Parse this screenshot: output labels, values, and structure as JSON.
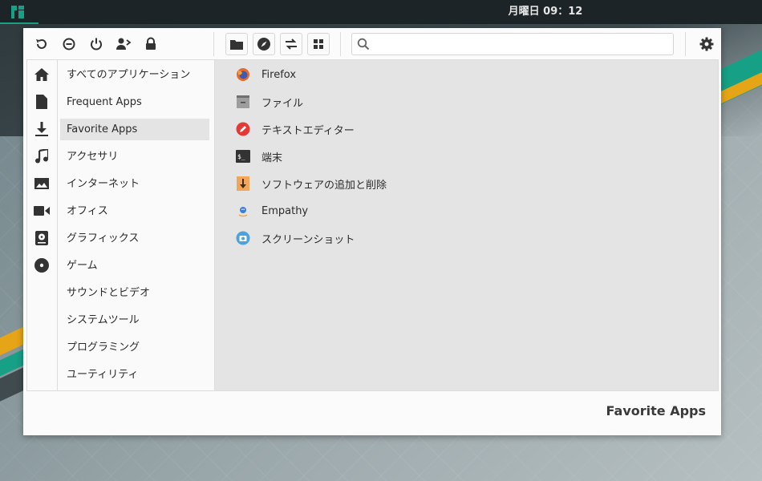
{
  "panel": {
    "clock": "月曜日 09：12"
  },
  "toolbar": {
    "left_icons": [
      "refresh-icon",
      "lock-screen-icon",
      "power-icon",
      "switch-user-icon",
      "lock-icon"
    ],
    "place_icons": [
      "folder-icon",
      "compass-icon",
      "switch-view-icon",
      "grid-icon"
    ],
    "search_placeholder": ""
  },
  "sidebar_icons": [
    "home-icon",
    "document-icon",
    "download-icon",
    "music-icon",
    "image-icon",
    "video-icon",
    "drive-icon",
    "disc-icon"
  ],
  "categories": [
    "すべてのアプリケーション",
    "Frequent Apps",
    "Favorite Apps",
    "アクセサリ",
    "インターネット",
    "オフィス",
    "グラフィックス",
    "ゲーム",
    "サウンドとビデオ",
    "システムツール",
    "プログラミング",
    "ユーティリティ"
  ],
  "active_category": "Favorite Apps",
  "apps": [
    {
      "label": "Firefox",
      "icon": "firefox-icon"
    },
    {
      "label": "ファイル",
      "icon": "files-icon"
    },
    {
      "label": "テキストエディター",
      "icon": "text-editor-icon"
    },
    {
      "label": "端末",
      "icon": "terminal-icon"
    },
    {
      "label": "ソフトウェアの追加と削除",
      "icon": "software-icon"
    },
    {
      "label": "Empathy",
      "icon": "empathy-icon"
    },
    {
      "label": "スクリーンショット",
      "icon": "screenshot-icon"
    }
  ],
  "footer": {
    "title": "Favorite Apps"
  },
  "colors": {
    "accent": "#16a085",
    "panel": "#1d2427",
    "selection": "#e4e4e4"
  }
}
